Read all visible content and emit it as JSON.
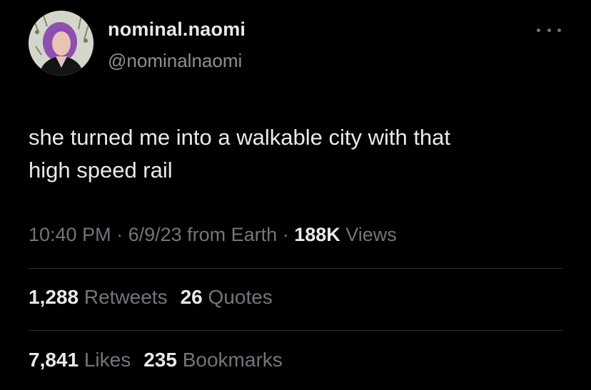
{
  "author": {
    "display_name": "nominal.naomi",
    "handle": "@nominalnaomi"
  },
  "more_icon": "more-horizontal-icon",
  "tweet": {
    "text_line1": "she turned me into a walkable city with that",
    "text_line2": "high speed rail"
  },
  "meta": {
    "time": "10:40 PM",
    "sep1": " · ",
    "date": "6/9/23",
    "source": " from Earth",
    "sep2": " · ",
    "views_count": "188K",
    "views_label": " Views"
  },
  "stats": {
    "retweets_count": "1,288",
    "retweets_label": "Retweets",
    "quotes_count": "26",
    "quotes_label": "Quotes",
    "likes_count": "7,841",
    "likes_label": "Likes",
    "bookmarks_count": "235",
    "bookmarks_label": "Bookmarks"
  },
  "colors": {
    "background": "#000000",
    "primary_text": "#e7e9ea",
    "secondary_text": "#71767b",
    "divider": "#2f3336",
    "avatar_hair": "#8e4fb0"
  }
}
